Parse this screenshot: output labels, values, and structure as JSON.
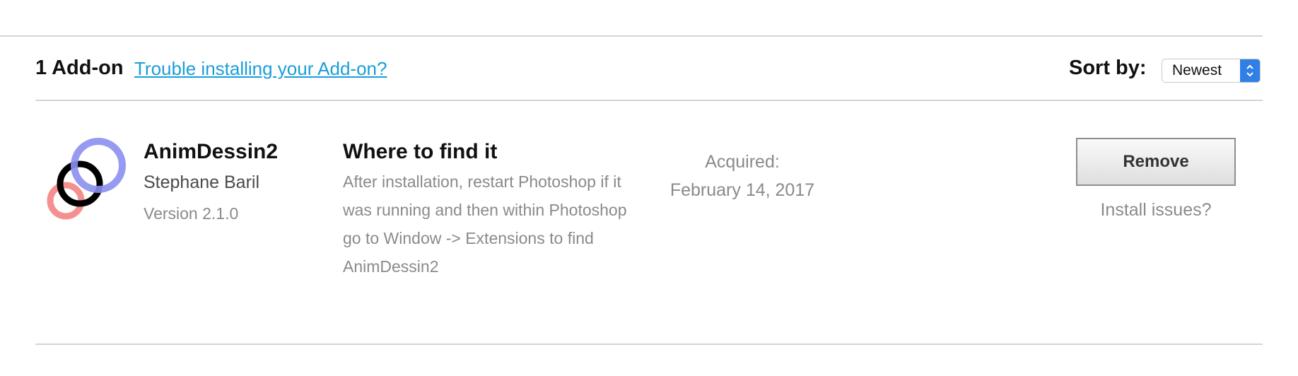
{
  "header": {
    "count_label": "1 Add-on",
    "help_link": "Trouble installing your Add-on?",
    "sort_label": "Sort by:",
    "sort_selected": "Newest"
  },
  "addon": {
    "icon": "overlapping-rings-icon",
    "icon_colors": {
      "blue_ring": "#8b8ff0",
      "black_ring": "#000000",
      "red_ring": "#f58a8a"
    },
    "name": "AnimDessin2",
    "author": "Stephane Baril",
    "version": "Version 2.1.0",
    "where_title": "Where to find it",
    "where_lines": [
      "After installation, restart Photoshop if it",
      "was running and then within Photoshop",
      "go to Window -> Extensions to find",
      "AnimDessin2"
    ],
    "acquired_label": "Acquired:",
    "acquired_date": "February 14, 2017",
    "remove_label": "Remove",
    "install_issues_label": "Install issues?"
  },
  "colors": {
    "link": "#1a9ed8",
    "select_accent": "#2f7fe4",
    "muted_text": "#8a8a8a",
    "divider": "#d4d4d4"
  }
}
